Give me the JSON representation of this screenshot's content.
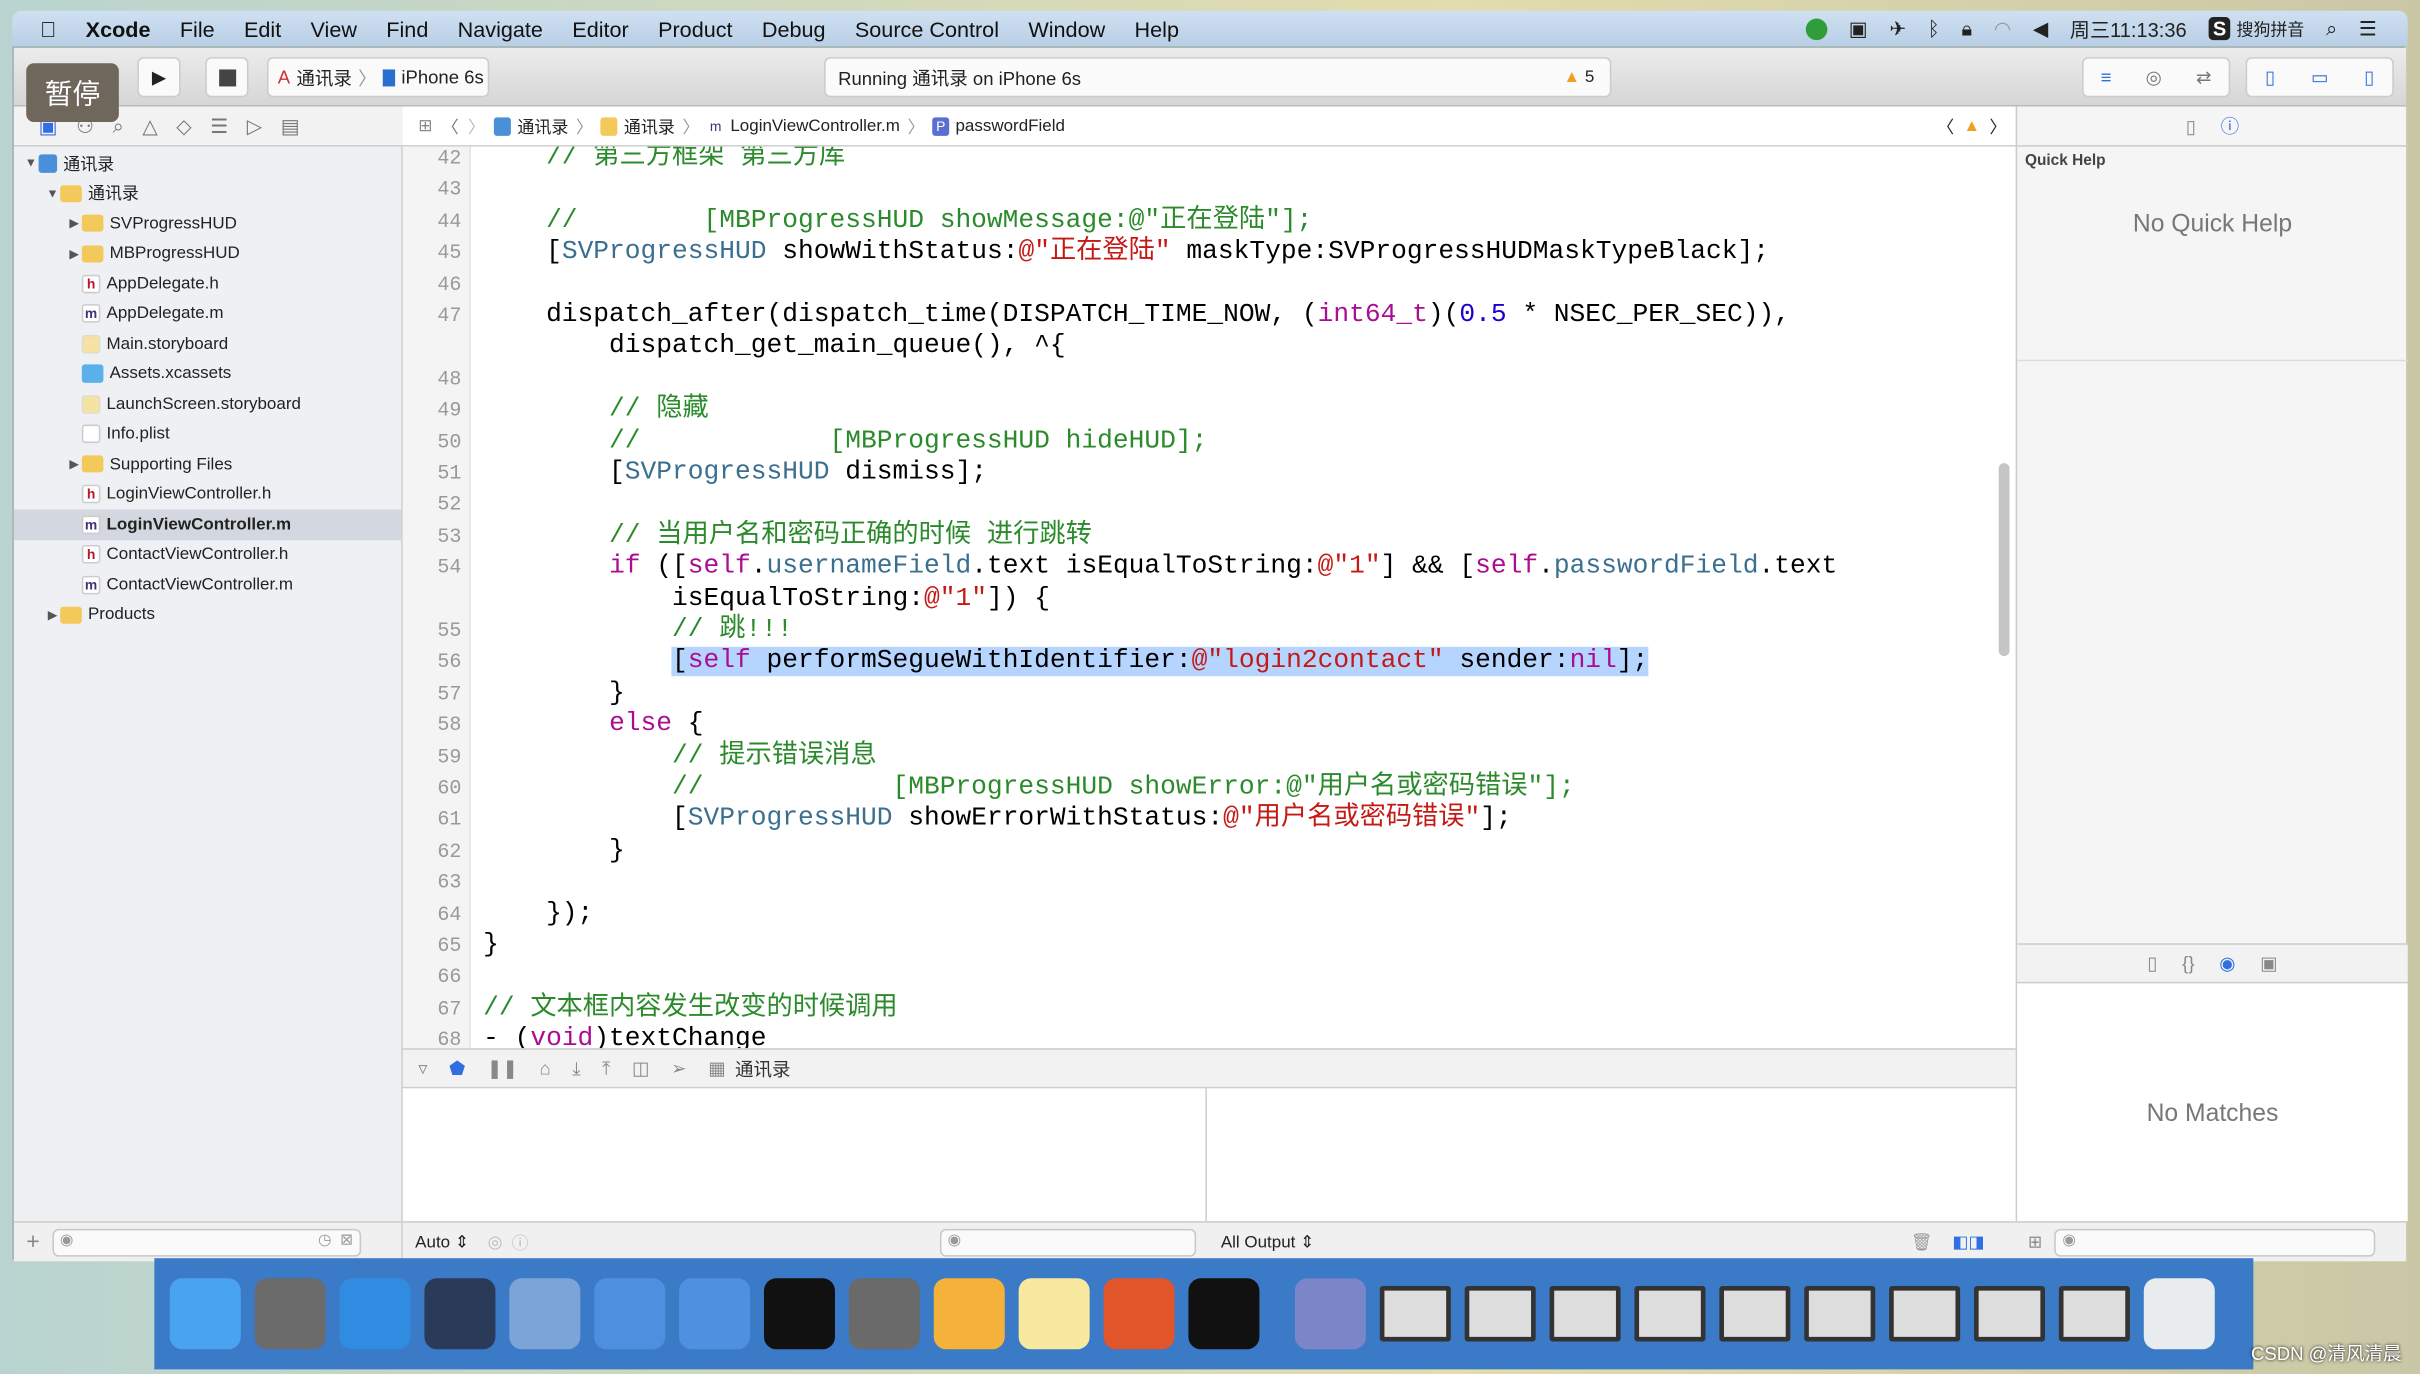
{
  "menubar": {
    "app": "Xcode",
    "items": [
      "File",
      "Edit",
      "View",
      "Find",
      "Navigate",
      "Editor",
      "Product",
      "Debug",
      "Source Control",
      "Window",
      "Help"
    ],
    "clock": "周三11:13:36",
    "ime": "搜狗拼音"
  },
  "overlay": {
    "pause_label": "暂停"
  },
  "toolbar": {
    "scheme": "通讯录",
    "device": "iPhone 6s",
    "status": "Running 通讯录 on iPhone 6s",
    "warning_count": "5"
  },
  "jumpbar": {
    "items": [
      "通讯录",
      "通讯录",
      "LoginViewController.m",
      "passwordField"
    ]
  },
  "navigator": {
    "items": [
      {
        "label": "通讯录",
        "icon": "proj",
        "level": 0,
        "disc": "▼"
      },
      {
        "label": "通讯录",
        "icon": "folder",
        "level": 1,
        "disc": "▼"
      },
      {
        "label": "SVProgressHUD",
        "icon": "folder",
        "level": 2,
        "disc": "▶"
      },
      {
        "label": "MBProgressHUD",
        "icon": "folder",
        "level": 2,
        "disc": "▶"
      },
      {
        "label": "AppDelegate.h",
        "icon": "h",
        "level": 2,
        "disc": ""
      },
      {
        "label": "AppDelegate.m",
        "icon": "m",
        "level": 2,
        "disc": ""
      },
      {
        "label": "Main.storyboard",
        "icon": "sb",
        "level": 2,
        "disc": ""
      },
      {
        "label": "Assets.xcassets",
        "icon": "assets",
        "level": 2,
        "disc": ""
      },
      {
        "label": "LaunchScreen.storyboard",
        "icon": "sb",
        "level": 2,
        "disc": ""
      },
      {
        "label": "Info.plist",
        "icon": "plist",
        "level": 2,
        "disc": ""
      },
      {
        "label": "Supporting Files",
        "icon": "folder",
        "level": 2,
        "disc": "▶"
      },
      {
        "label": "LoginViewController.h",
        "icon": "h",
        "level": 2,
        "disc": ""
      },
      {
        "label": "LoginViewController.m",
        "icon": "m",
        "level": 2,
        "disc": "",
        "selected": true
      },
      {
        "label": "ContactViewController.h",
        "icon": "h",
        "level": 2,
        "disc": ""
      },
      {
        "label": "ContactViewController.m",
        "icon": "m",
        "level": 2,
        "disc": ""
      },
      {
        "label": "Products",
        "icon": "folder",
        "level": 1,
        "disc": "▶"
      }
    ]
  },
  "editor": {
    "lines": [
      {
        "n": "42",
        "rows": [
          [
            [
              "c",
              "    // 第三方框架 第三方库"
            ]
          ]
        ]
      },
      {
        "n": "43",
        "rows": [
          []
        ]
      },
      {
        "n": "44",
        "rows": [
          [
            [
              "c",
              "    //        [MBProgressHUD showMessage:@\"正在登陆\"];"
            ]
          ]
        ]
      },
      {
        "n": "45",
        "rows": [
          [
            [
              "p",
              "    ["
            ],
            [
              "t",
              "SVProgressHUD"
            ],
            [
              "p",
              " showWithStatus:"
            ],
            [
              "s",
              "@\"正在登陆\""
            ],
            [
              "p",
              " maskType:SVProgressHUDMaskTypeBlack];"
            ]
          ]
        ]
      },
      {
        "n": "46",
        "rows": [
          []
        ]
      },
      {
        "n": "47",
        "rows": [
          [
            [
              "p",
              "    dispatch_after(dispatch_time(DISPATCH_TIME_NOW, ("
            ],
            [
              "k",
              "int64_t"
            ],
            [
              "p",
              ")("
            ],
            [
              "n",
              "0.5"
            ],
            [
              "p",
              " * NSEC_PER_SEC)),"
            ]
          ],
          [
            [
              "p",
              "        dispatch_get_main_queue(), ^{"
            ]
          ]
        ]
      },
      {
        "n": "48",
        "rows": [
          []
        ]
      },
      {
        "n": "49",
        "rows": [
          [
            [
              "c",
              "        // 隐藏"
            ]
          ]
        ]
      },
      {
        "n": "50",
        "rows": [
          [
            [
              "c",
              "        //            [MBProgressHUD hideHUD];"
            ]
          ]
        ]
      },
      {
        "n": "51",
        "rows": [
          [
            [
              "p",
              "        ["
            ],
            [
              "t",
              "SVProgressHUD"
            ],
            [
              "p",
              " dismiss];"
            ]
          ]
        ]
      },
      {
        "n": "52",
        "rows": [
          []
        ]
      },
      {
        "n": "53",
        "rows": [
          [
            [
              "c",
              "        // 当用户名和密码正确的时候 进行跳转"
            ]
          ]
        ]
      },
      {
        "n": "54",
        "rows": [
          [
            [
              "p",
              "        "
            ],
            [
              "k",
              "if"
            ],
            [
              "p",
              " (["
            ],
            [
              "k",
              "self"
            ],
            [
              "p",
              "."
            ],
            [
              "t",
              "usernameField"
            ],
            [
              "p",
              ".text isEqualToString:"
            ],
            [
              "s",
              "@\"1\""
            ],
            [
              "p",
              "] && ["
            ],
            [
              "k",
              "self"
            ],
            [
              "p",
              "."
            ],
            [
              "t",
              "passwordField"
            ],
            [
              "p",
              ".text"
            ]
          ],
          [
            [
              "p",
              "            isEqualToString:"
            ],
            [
              "s",
              "@\"1\""
            ],
            [
              "p",
              "]) {"
            ]
          ]
        ]
      },
      {
        "n": "55",
        "rows": [
          [
            [
              "c",
              "            // 跳!!!"
            ]
          ]
        ]
      },
      {
        "n": "56",
        "selected": true,
        "rows": [
          [
            [
              "p",
              "            ["
            ],
            [
              "k",
              "self"
            ],
            [
              "p",
              " performSegueWithIdentifier:"
            ],
            [
              "s",
              "@\"login2contact\""
            ],
            [
              "p",
              " sender:"
            ],
            [
              "k",
              "nil"
            ],
            [
              "p",
              "];"
            ]
          ]
        ]
      },
      {
        "n": "57",
        "rows": [
          [
            [
              "p",
              "        }"
            ]
          ]
        ]
      },
      {
        "n": "58",
        "rows": [
          [
            [
              "p",
              "        "
            ],
            [
              "k",
              "else"
            ],
            [
              "p",
              " {"
            ]
          ]
        ]
      },
      {
        "n": "59",
        "rows": [
          [
            [
              "c",
              "            // 提示错误消息"
            ]
          ]
        ]
      },
      {
        "n": "60",
        "rows": [
          [
            [
              "c",
              "            //            [MBProgressHUD showError:@\"用户名或密码错误\"];"
            ]
          ]
        ]
      },
      {
        "n": "61",
        "rows": [
          [
            [
              "p",
              "            ["
            ],
            [
              "t",
              "SVProgressHUD"
            ],
            [
              "p",
              " showErrorWithStatus:"
            ],
            [
              "s",
              "@\"用户名或密码错误\""
            ],
            [
              "p",
              "];"
            ]
          ]
        ]
      },
      {
        "n": "62",
        "rows": [
          [
            [
              "p",
              "        }"
            ]
          ]
        ]
      },
      {
        "n": "63",
        "rows": [
          []
        ]
      },
      {
        "n": "64",
        "rows": [
          [
            [
              "p",
              "    });"
            ]
          ]
        ]
      },
      {
        "n": "65",
        "rows": [
          [
            [
              "p",
              "}"
            ]
          ]
        ]
      },
      {
        "n": "66",
        "rows": [
          []
        ]
      },
      {
        "n": "67",
        "rows": [
          [
            [
              "c",
              "// 文本框内容发生改变的时候调用"
            ]
          ]
        ]
      },
      {
        "n": "68",
        "rows": [
          [
            [
              "p",
              "- ("
            ],
            [
              "k",
              "void"
            ],
            [
              "p",
              ")textChange"
            ]
          ]
        ]
      }
    ]
  },
  "debug": {
    "target": "通讯录",
    "auto_label": "Auto ⇕",
    "output_label": "All Output ⇕"
  },
  "inspector": {
    "title": "Quick Help",
    "no_help": "No Quick Help",
    "no_matches": "No Matches"
  },
  "dock": {
    "apps": [
      "finder",
      "launchpad",
      "safari",
      "mouse",
      "photo-booth",
      "xcode",
      "simulator",
      "terminal",
      "system-preferences",
      "sketch",
      "notes",
      "powerpoint",
      "console",
      "media-player",
      "window-1",
      "window-2",
      "window-3",
      "window-4",
      "window-5",
      "window-6",
      "window-7",
      "window-8",
      "window-9",
      "trash"
    ],
    "colors": [
      "#4aa3f0",
      "#6b6b6b",
      "#2f8ce0",
      "#2a3b5a",
      "#7da4d8",
      "#4e8fe0",
      "#4f90e0",
      "#111111",
      "#6a6a6a",
      "#f4b23a",
      "#f7e9a0",
      "#e0552a",
      "#111111",
      "#7a86c8",
      "#dddddd",
      "#dddddd",
      "#dddddd",
      "#dddddd",
      "#dddddd",
      "#dddddd",
      "#dddddd",
      "#dddddd",
      "#dddddd",
      "#e8ecef"
    ]
  },
  "watermark": "CSDN @清风清晨",
  "colors": {
    "comment": "#2b8a2b",
    "string": "#c41a16",
    "keyword": "#aa0d91",
    "selection": "#b5d5ff",
    "accent": "#2f6fe0",
    "warning": "#f0a020"
  }
}
